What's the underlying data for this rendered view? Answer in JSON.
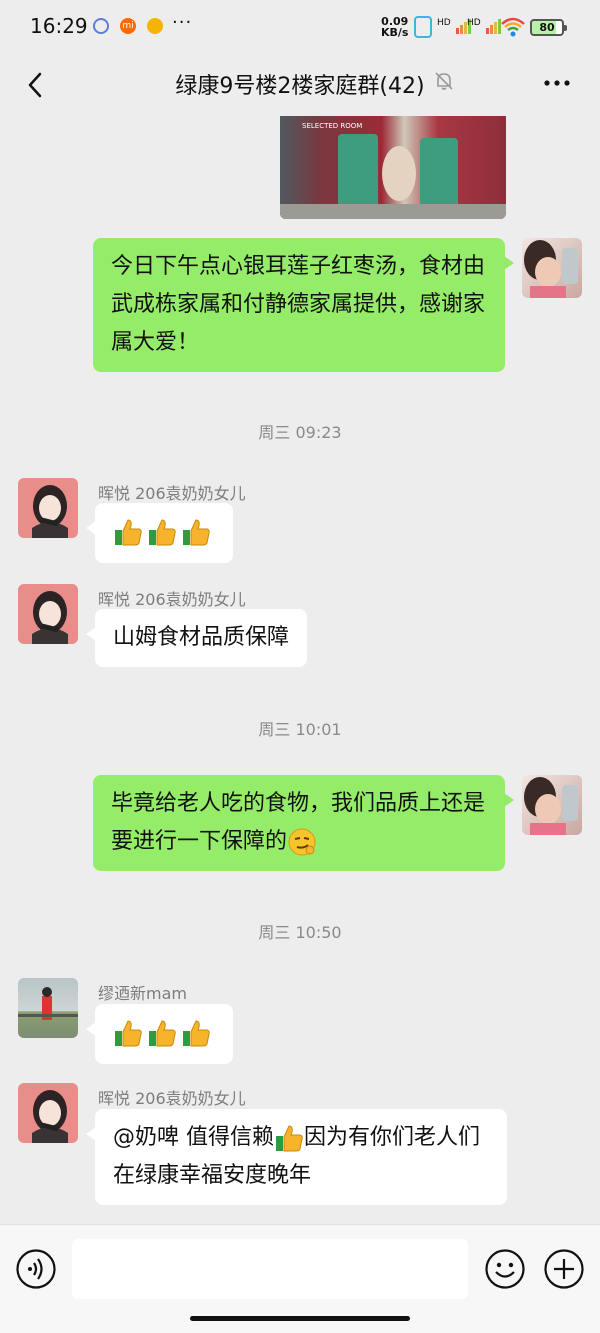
{
  "status": {
    "time": "16:29",
    "net_speed_value": "0.09",
    "net_speed_unit": "KB/s",
    "sim1_label": "HD",
    "sim2_label": "HD",
    "battery": "80",
    "more_notifications": "···"
  },
  "header": {
    "title": "绿康9号楼2楼家庭群(42)"
  },
  "messages": {
    "m1_text": "今日下午点心银耳莲子红枣汤，食材由武成栋家属和付静德家属提供，感谢家属大爱！",
    "ts1": "周三 09:23",
    "m2_sender": "晖悦 206袁奶奶女儿",
    "m3_sender": "晖悦 206袁奶奶女儿",
    "m3_text": "山姆食材品质保障",
    "ts2": "周三 10:01",
    "m4_text": "毕竟给老人吃的食物，我们品质上还是要进行一下保障的",
    "ts3": "周三 10:50",
    "m5_sender": "缪迺新mam",
    "m6_sender": "晖悦 206袁奶奶女儿",
    "m6_text_a": "@奶啤  值得信赖",
    "m6_text_b": "因为有你们老人们在绿康幸福安度晚年",
    "photo_label": "SELECTED ROOM"
  },
  "input": {
    "placeholder": ""
  },
  "icons": {
    "back": "chevron-left-icon",
    "mute": "bell-off-icon",
    "more": "more-horizontal-icon",
    "voice": "voice-icon",
    "emoji": "smile-icon",
    "plus": "plus-icon",
    "thumbs": "thumbs-up-icon"
  },
  "colors": {
    "green_bubble": "#95ec69",
    "white_bubble": "#ffffff",
    "background": "#ededed"
  }
}
